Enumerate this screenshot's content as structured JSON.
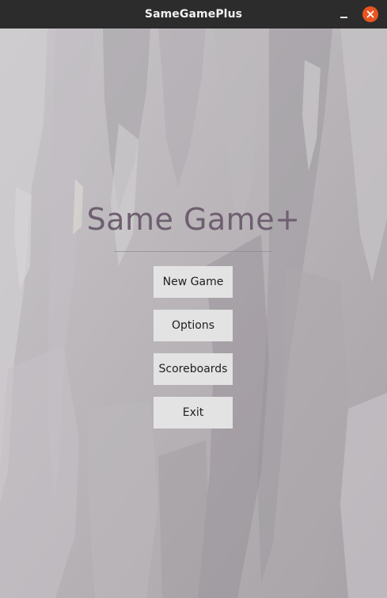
{
  "window": {
    "title": "SameGamePlus",
    "close_color": "#e95420"
  },
  "main": {
    "heading": "Same Game+",
    "heading_color": "#6e5f70"
  },
  "menu": {
    "new_game": "New Game",
    "options": "Options",
    "scoreboards": "Scoreboards",
    "exit": "Exit"
  },
  "icons": {
    "minimize": "minimize-icon",
    "close": "close-icon"
  }
}
